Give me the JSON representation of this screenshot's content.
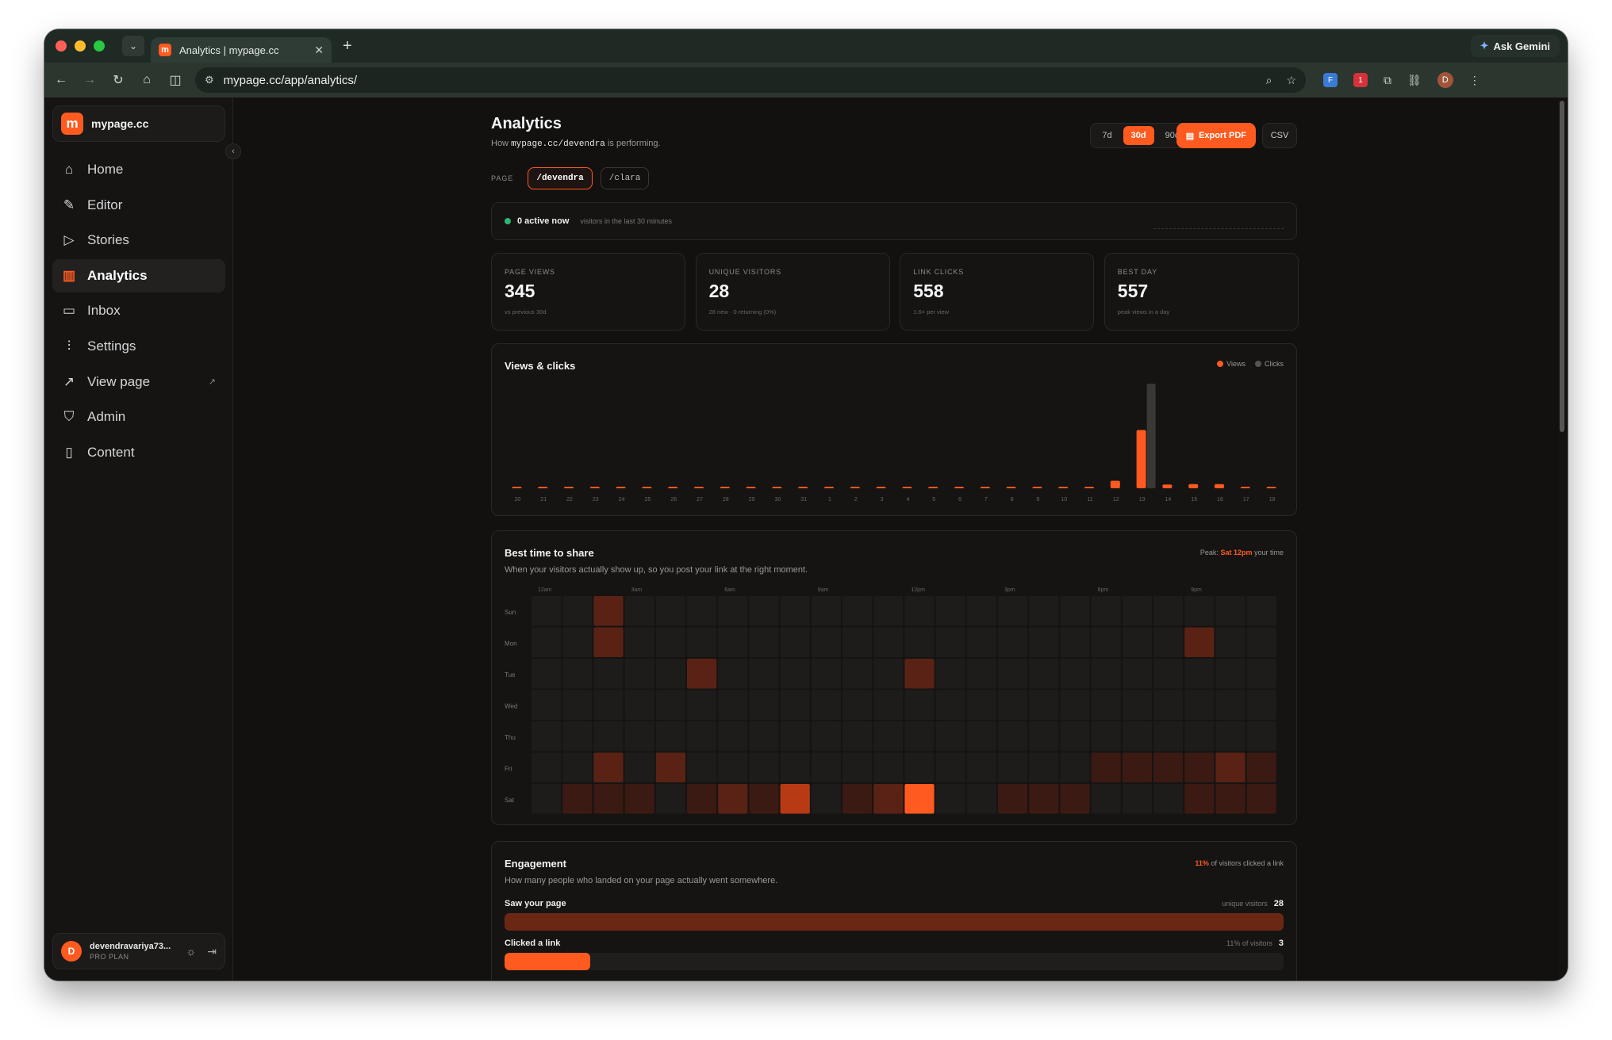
{
  "browser": {
    "tab_title": "Analytics | mypage.cc",
    "tab_favicon": "m",
    "url": "mypage.cc/app/analytics/",
    "ask_gemini": "Ask Gemini",
    "profile_initial": "D",
    "ext_badge": "1"
  },
  "sidebar": {
    "brand_logo": "m",
    "brand_name": "mypage.cc",
    "items": [
      {
        "label": "Home",
        "icon": "home-icon"
      },
      {
        "label": "Editor",
        "icon": "pencil-icon"
      },
      {
        "label": "Stories",
        "icon": "play-circle-icon"
      },
      {
        "label": "Analytics",
        "icon": "bar-chart-icon",
        "active": true
      },
      {
        "label": "Inbox",
        "icon": "inbox-icon"
      },
      {
        "label": "Settings",
        "icon": "sliders-icon"
      },
      {
        "label": "View page",
        "icon": "external-link-icon",
        "external": true
      },
      {
        "label": "Admin",
        "icon": "shield-icon"
      },
      {
        "label": "Content",
        "icon": "file-icon"
      }
    ],
    "user": {
      "initial": "D",
      "name": "devendravariya73...",
      "plan": "PRO PLAN"
    }
  },
  "header": {
    "title": "Analytics",
    "subtitle_prefix": "How",
    "subtitle_path": "mypage.cc/devendra",
    "subtitle_suffix": "is performing.",
    "ranges": [
      "7d",
      "30d",
      "90d"
    ],
    "active_range": "30d",
    "export_label": "Export PDF",
    "csv_label": "CSV"
  },
  "page_selector": {
    "label": "PAGE",
    "pages": [
      "/devendra",
      "/clara"
    ],
    "active": "/devendra"
  },
  "active_now": {
    "text": "0 active now",
    "sub": "visitors in the last 30 minutes"
  },
  "stats": [
    {
      "label": "PAGE VIEWS",
      "value": "345",
      "sub": "vs previous 30d"
    },
    {
      "label": "UNIQUE VISITORS",
      "value": "28",
      "sub": "28 new · 0 returning (0%)"
    },
    {
      "label": "LINK CLICKS",
      "value": "558",
      "sub": "1.6× per view"
    },
    {
      "label": "BEST DAY",
      "value": "557",
      "sub": "peak views in a day"
    }
  ],
  "chart_data": {
    "type": "bar",
    "title": "Views & clicks",
    "categories": [
      "20",
      "21",
      "22",
      "23",
      "24",
      "25",
      "26",
      "27",
      "28",
      "29",
      "30",
      "31",
      "1",
      "2",
      "3",
      "4",
      "5",
      "6",
      "7",
      "8",
      "9",
      "10",
      "11",
      "12",
      "13",
      "14",
      "15",
      "16",
      "17",
      "18"
    ],
    "series": [
      {
        "name": "Views",
        "values": [
          0,
          0,
          0,
          0,
          0,
          0,
          0,
          0,
          0,
          0,
          0,
          0,
          0,
          0,
          0,
          0,
          0,
          0,
          0,
          0,
          0,
          0,
          0,
          40,
          310,
          20,
          22,
          22,
          0,
          0
        ]
      },
      {
        "name": "Clicks",
        "values": [
          0,
          0,
          0,
          0,
          0,
          0,
          0,
          0,
          0,
          0,
          0,
          0,
          0,
          0,
          0,
          0,
          0,
          0,
          0,
          0,
          0,
          0,
          0,
          0,
          557,
          0,
          0,
          0,
          0,
          0
        ]
      }
    ],
    "legend": "top-right",
    "colors": {
      "Views": "#ff5a1f",
      "Clicks": "#3a3836"
    }
  },
  "best_time": {
    "title": "Best time to share",
    "desc": "When your visitors actually show up, so you post your link at the right moment.",
    "peak_prefix": "Peak:",
    "peak_value": "Sat 12pm",
    "peak_suffix": "your time",
    "hour_labels": [
      {
        "h": 0,
        "label": "12am"
      },
      {
        "h": 3,
        "label": "3am"
      },
      {
        "h": 6,
        "label": "6am"
      },
      {
        "h": 9,
        "label": "9am"
      },
      {
        "h": 12,
        "label": "12pm"
      },
      {
        "h": 15,
        "label": "3pm"
      },
      {
        "h": 18,
        "label": "6pm"
      },
      {
        "h": 21,
        "label": "9pm"
      }
    ],
    "days": [
      "Sun",
      "Mon",
      "Tue",
      "Wed",
      "Thu",
      "Fri",
      "Sat"
    ],
    "matrix": [
      [
        0,
        0,
        2,
        0,
        0,
        0,
        0,
        0,
        0,
        0,
        0,
        0,
        0,
        0,
        0,
        0,
        0,
        0,
        0,
        0,
        0,
        0,
        0,
        0
      ],
      [
        0,
        0,
        2,
        0,
        0,
        0,
        0,
        0,
        0,
        0,
        0,
        0,
        0,
        0,
        0,
        0,
        0,
        0,
        0,
        0,
        0,
        2,
        0,
        0
      ],
      [
        0,
        0,
        0,
        0,
        0,
        2,
        0,
        0,
        0,
        0,
        0,
        0,
        2,
        0,
        0,
        0,
        0,
        0,
        0,
        0,
        0,
        0,
        0,
        0
      ],
      [
        0,
        0,
        0,
        0,
        0,
        0,
        0,
        0,
        0,
        0,
        0,
        0,
        0,
        0,
        0,
        0,
        0,
        0,
        0,
        0,
        0,
        0,
        0,
        0
      ],
      [
        0,
        0,
        0,
        0,
        0,
        0,
        0,
        0,
        0,
        0,
        0,
        0,
        0,
        0,
        0,
        0,
        0,
        0,
        0,
        0,
        0,
        0,
        0,
        0
      ],
      [
        0,
        0,
        2,
        0,
        2,
        0,
        0,
        0,
        0,
        0,
        0,
        0,
        0,
        0,
        0,
        0,
        0,
        0,
        1,
        1,
        1,
        1,
        2,
        1
      ],
      [
        0,
        1,
        1,
        1,
        0,
        1,
        2,
        1,
        3,
        0,
        1,
        2,
        4,
        0,
        0,
        1,
        1,
        1,
        0,
        0,
        0,
        1,
        1,
        1
      ]
    ],
    "colors": [
      "#1d1c1b",
      "#3a1a12",
      "#5a2214",
      "#b83a14",
      "#ff5a1f"
    ]
  },
  "engagement": {
    "title": "Engagement",
    "desc": "How many people who landed on your page actually went somewhere.",
    "right_highlight": "11%",
    "right_text": "of visitors clicked a link",
    "rows": [
      {
        "label": "Saw your page",
        "meta": "unique visitors",
        "value": "28",
        "fraction": 1.0,
        "color": "#6a2814"
      },
      {
        "label": "Clicked a link",
        "meta": "11% of visitors",
        "value": "3",
        "fraction": 0.11,
        "color": "#ff5a1f"
      }
    ]
  }
}
